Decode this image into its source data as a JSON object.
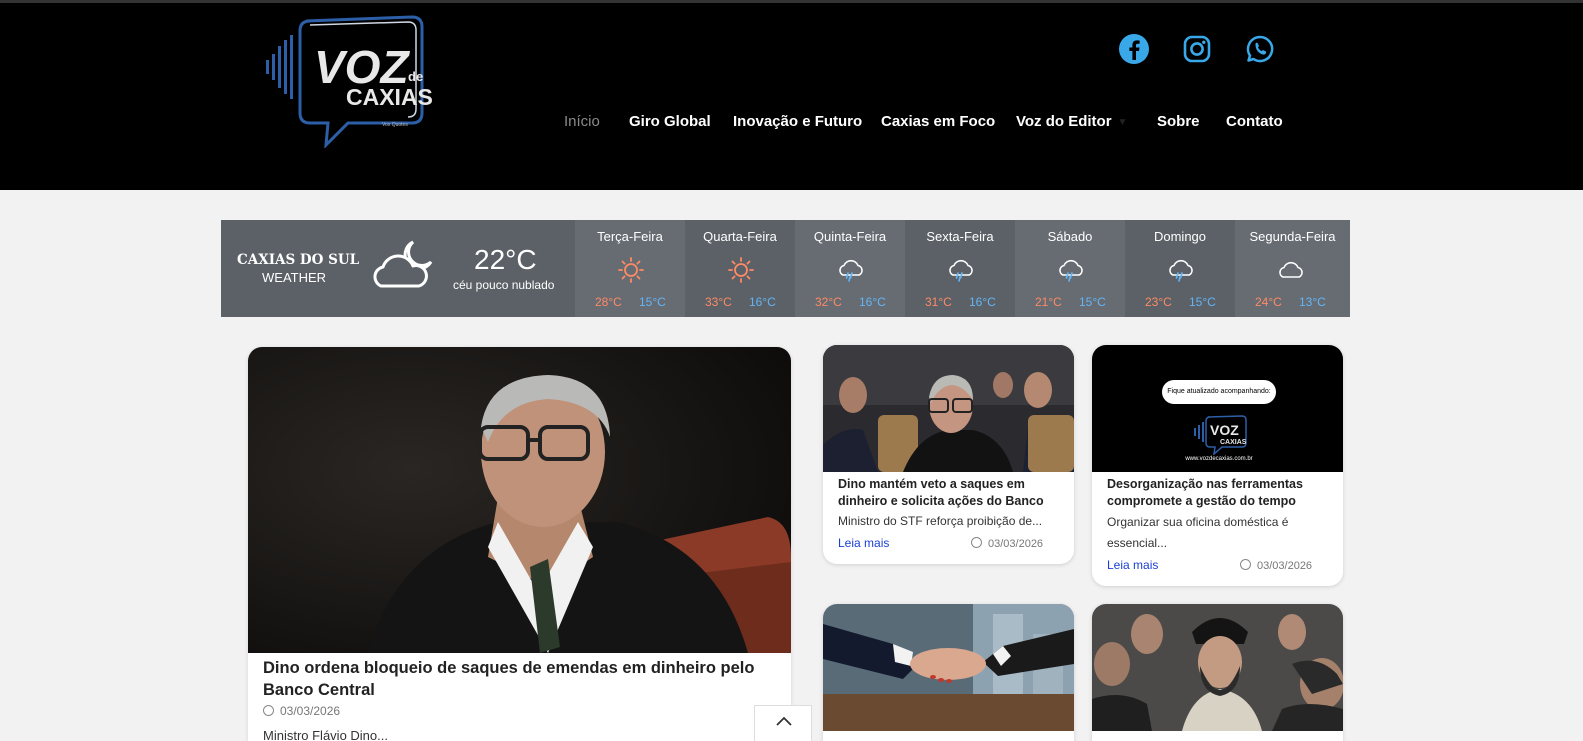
{
  "brand": {
    "logo_text_main": "VOZ",
    "logo_text_de": "de",
    "logo_text_sub": "CAXIAS",
    "logo_small": "Vox Quotes"
  },
  "social": [
    {
      "name": "facebook-icon"
    },
    {
      "name": "instagram-icon"
    },
    {
      "name": "whatsapp-icon"
    }
  ],
  "nav": {
    "items": [
      "Início",
      "Giro Global",
      "Inovação e Futuro",
      "Caxias em Foco",
      "Voz do Editor",
      "Sobre",
      "Contato"
    ],
    "active_index": 0,
    "dropdown_index": 4
  },
  "weather": {
    "city": "CAXIAS DO SUL",
    "label": "WEATHER",
    "current_temp": "22°C",
    "description": "céu pouco nublado",
    "icon": "cloud-moon-icon",
    "days": [
      {
        "name": "Terça-Feira",
        "icon": "sun-icon",
        "high": "28°C",
        "low": "15°C"
      },
      {
        "name": "Quarta-Feira",
        "icon": "sun-icon",
        "high": "33°C",
        "low": "16°C"
      },
      {
        "name": "Quinta-Feira",
        "icon": "rain-cloud-icon",
        "high": "32°C",
        "low": "16°C"
      },
      {
        "name": "Sexta-Feira",
        "icon": "rain-cloud-icon",
        "high": "31°C",
        "low": "16°C"
      },
      {
        "name": "Sábado",
        "icon": "rain-cloud-icon",
        "high": "21°C",
        "low": "15°C"
      },
      {
        "name": "Domingo",
        "icon": "rain-cloud-icon",
        "high": "23°C",
        "low": "15°C"
      },
      {
        "name": "Segunda-Feira",
        "icon": "cloud-icon",
        "high": "24°C",
        "low": "13°C"
      }
    ],
    "colors": {
      "high": "#ff8a65",
      "low": "#64b5f6"
    }
  },
  "feature": {
    "title": "Dino ordena bloqueio de saques de emendas em dinheiro pelo Banco Central",
    "date": "03/03/2026",
    "excerpt": "Ministro Flávio Dino..."
  },
  "cards": [
    {
      "title": "Dino mantém veto a saques em dinheiro e solicita ações do Banco",
      "excerpt": "Ministro do STF reforça proibição de...",
      "more": "Leia mais",
      "date": "03/03/2026"
    },
    {
      "title": "Desorganização nas ferramentas compromete a gestão do tempo",
      "excerpt": "Organizar sua oficina doméstica é essencial...",
      "more": "Leia mais",
      "date": "03/03/2026",
      "image_banner": "Fique atualizado acompanhando:",
      "image_url": "www.vozdecaxias.com.br"
    }
  ]
}
